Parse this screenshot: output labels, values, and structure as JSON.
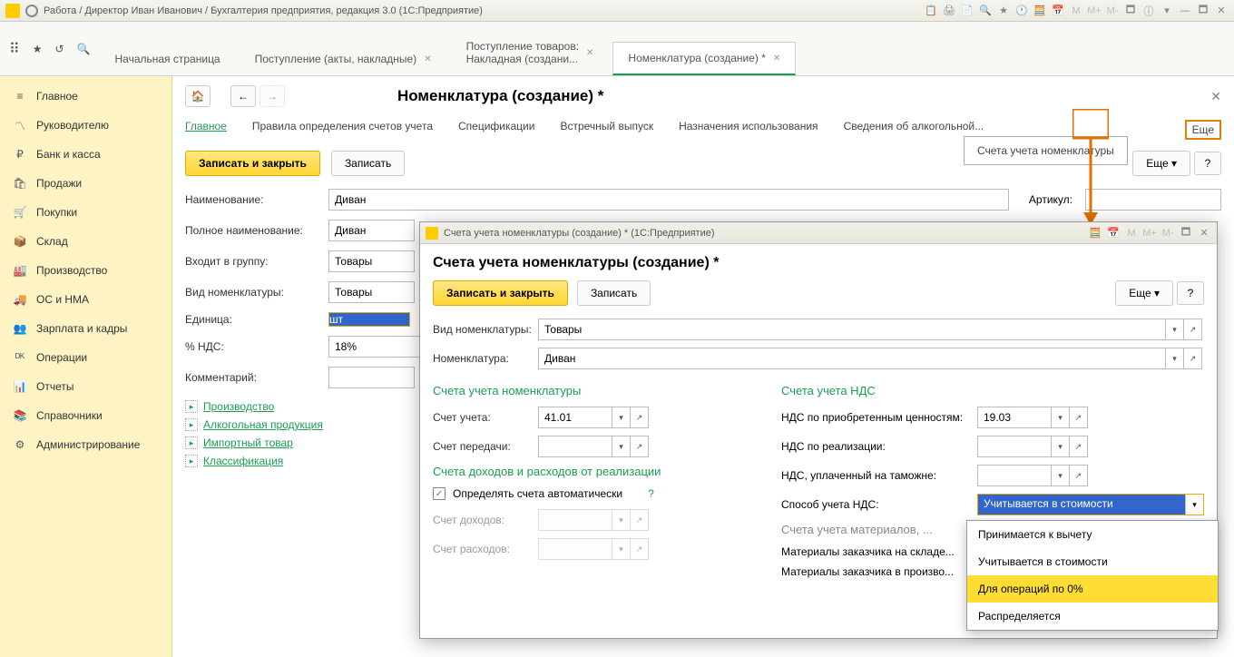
{
  "titlebar": {
    "text": "Работа / Директор Иван Иванович / Бухгалтерия предприятия, редакция 3.0  (1С:Предприятие)"
  },
  "tabs": {
    "home": "Начальная страница",
    "t1": "Поступление (акты, накладные)",
    "t2_l1": "Поступление товаров:",
    "t2_l2": "Накладная (создани...",
    "t3": "Номенклатура (создание) *"
  },
  "sidebar": {
    "items": [
      "Главное",
      "Руководителю",
      "Банк и касса",
      "Продажи",
      "Покупки",
      "Склад",
      "Производство",
      "ОС и НМА",
      "Зарплата и кадры",
      "Операции",
      "Отчеты",
      "Справочники",
      "Администрирование"
    ]
  },
  "page": {
    "title": "Номенклатура (создание) *",
    "subnav": [
      "Главное",
      "Правила определения счетов учета",
      "Спецификации",
      "Встречный выпуск",
      "Назначения использования",
      "Сведения об алкогольной..."
    ],
    "save_close": "Записать и закрыть",
    "save": "Записать",
    "more": "Еще",
    "tooltip": "Счета учета номенклатуры",
    "form": {
      "name_lbl": "Наименование:",
      "name_val": "Диван",
      "artikul_lbl": "Артикул:",
      "fullname_lbl": "Полное наименование:",
      "fullname_val": "Диван",
      "group_lbl": "Входит в группу:",
      "group_val": "Товары",
      "kind_lbl": "Вид номенклатуры:",
      "kind_val": "Товары",
      "unit_lbl": "Единица:",
      "unit_val": "шт",
      "vat_lbl": "% НДС:",
      "vat_val": "18%",
      "comment_lbl": "Комментарий:"
    },
    "links": [
      "Производство",
      "Алкогольная продукция",
      "Импортный товар",
      "Классификация"
    ]
  },
  "popup": {
    "titlebar": "Счета учета номенклатуры (создание) *  (1С:Предприятие)",
    "heading": "Счета учета номенклатуры (создание) *",
    "save_close": "Записать и закрыть",
    "save": "Записать",
    "more": "Еще",
    "kind_lbl": "Вид номенклатуры:",
    "kind_val": "Товары",
    "nom_lbl": "Номенклатура:",
    "nom_val": "Диван",
    "sec1": "Счета учета номенклатуры",
    "acc_lbl": "Счет учета:",
    "acc_val": "41.01",
    "trans_lbl": "Счет передачи:",
    "sec2": "Счета учета НДС",
    "vat_acq_lbl": "НДС по приобретенным ценностям:",
    "vat_acq_val": "19.03",
    "vat_real_lbl": "НДС по реализации:",
    "vat_cust_lbl": "НДС, уплаченный на таможне:",
    "vat_method_lbl": "Способ учета НДС:",
    "vat_method_val": "Учитывается в стоимости",
    "sec3": "Счета доходов и расходов от реализации",
    "auto_chk": "Определять счета автоматически",
    "income_lbl": "Счет доходов:",
    "expense_lbl": "Счет расходов:",
    "sec4": "Счета учета материалов, ...",
    "mat1_lbl": "Материалы заказчика на складе...",
    "mat2_lbl": "Материалы заказчика в произво..."
  },
  "dropdown": {
    "opt1": "Принимается к вычету",
    "opt2": "Учитывается в стоимости",
    "opt3": "Для операций по 0%",
    "opt4": "Распределяется"
  }
}
